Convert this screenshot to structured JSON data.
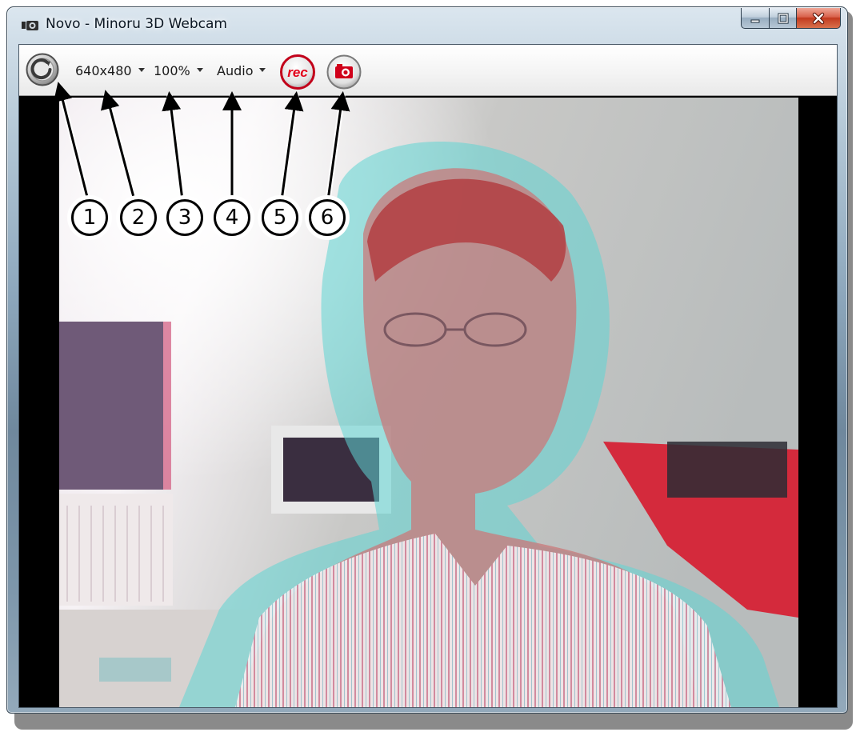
{
  "window": {
    "title": "Novo - Minoru 3D Webcam"
  },
  "toolbar": {
    "resolution": "640x480",
    "zoom": "100%",
    "audio": "Audio",
    "rec_label": "rec"
  },
  "callouts": [
    "1",
    "2",
    "3",
    "4",
    "5",
    "6"
  ],
  "icons": {
    "power": "power-icon",
    "record": "record-icon",
    "snapshot": "camera-icon"
  },
  "colors": {
    "rec_red": "#e2001a",
    "close_red": "#c23a1f"
  }
}
